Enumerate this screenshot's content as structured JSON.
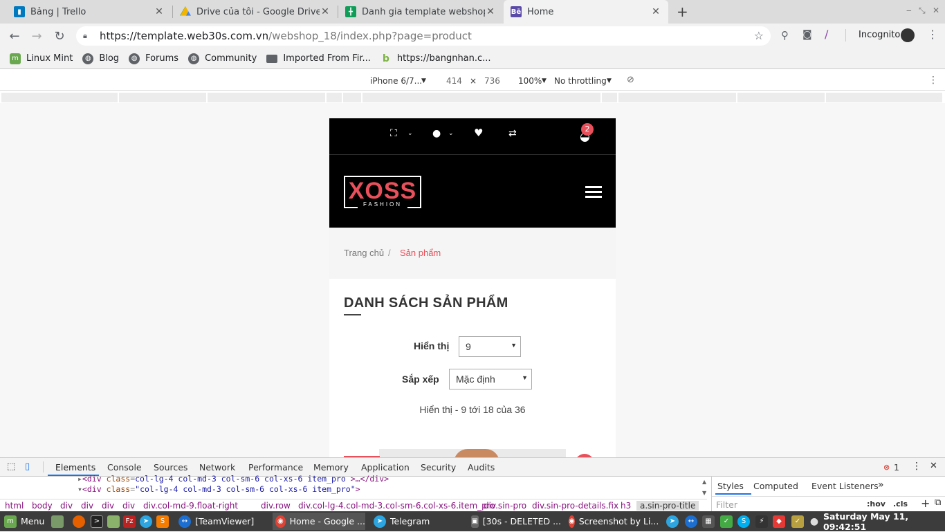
{
  "colors": {
    "accent": "#e8505b",
    "blue": "#1a73e8",
    "chrome_bg": "#dcdcdc",
    "toolbar_bg": "#f2f2f2"
  },
  "tabs": [
    {
      "title": "Bảng | Trello",
      "icon": "trello-icon"
    },
    {
      "title": "Drive của tôi - Google Drive",
      "icon": "google-drive-icon"
    },
    {
      "title": "Danh gia template webshop_18",
      "icon": "google-sheets-icon"
    },
    {
      "title": "Home",
      "icon": "behance-icon"
    }
  ],
  "toolbar": {
    "url_host": "https://template.web30s.com.vn",
    "url_path": "/webshop_18/index.php?page=product",
    "incognito_label": "Incognito"
  },
  "bookmarks": [
    "Linux Mint",
    "Blog",
    "Forums",
    "Community",
    "Imported From Fir...",
    "https://bangnhan.c..."
  ],
  "device_toolbar": {
    "device": "iPhone 6/7...",
    "width": "414",
    "times": "×",
    "height": "736",
    "zoom": "100%",
    "throttling": "No throttling"
  },
  "site": {
    "cart_count": "2",
    "logo_text": "XOSS",
    "logo_sub": "FASHION",
    "breadcrumb_home": "Trang chủ",
    "breadcrumb_sep": "/",
    "breadcrumb_current": "Sản phẩm",
    "page_title": "DANH SÁCH SẢN PHẨM",
    "show_label": "Hiển thị",
    "show_value": "9",
    "sort_label": "Sắp xếp",
    "sort_value": "Mặc định",
    "result_text": "Hiển thị - 9 tới 18 của 36"
  },
  "devtools": {
    "tabs": [
      "Elements",
      "Console",
      "Sources",
      "Network",
      "Performance",
      "Memory",
      "Application",
      "Security",
      "Audits"
    ],
    "error_count": "1",
    "code_line1_class": "col-lg-4 col-md-3 col-sm-6 col-xs-6 item_pro",
    "code_line2_class": "col-lg-4 col-md-3 col-sm-6 col-xs-6 item_pro",
    "side_tabs": [
      "Styles",
      "Computed",
      "Event Listeners"
    ],
    "filter_placeholder": "Filter",
    "hov": ":hov",
    "cls": ".cls",
    "path": [
      "html",
      "body",
      "div",
      "div",
      "div",
      "div",
      "div.col-md-9.float-right",
      "div.row",
      "div.col-lg-4.col-md-3.col-sm-6.col-xs-6.item_pro",
      "div.sin-pro",
      "div.sin-pro-details.fix",
      "h3",
      "a.sin-pro-title"
    ]
  },
  "taskbar": {
    "menu": "Menu",
    "windows": [
      "[TeamViewer]",
      "Home - Google ...",
      "Telegram",
      "[30s - DELETED ...",
      "Screenshot by Li..."
    ],
    "clock": "Saturday May 11, 09:42:51"
  }
}
